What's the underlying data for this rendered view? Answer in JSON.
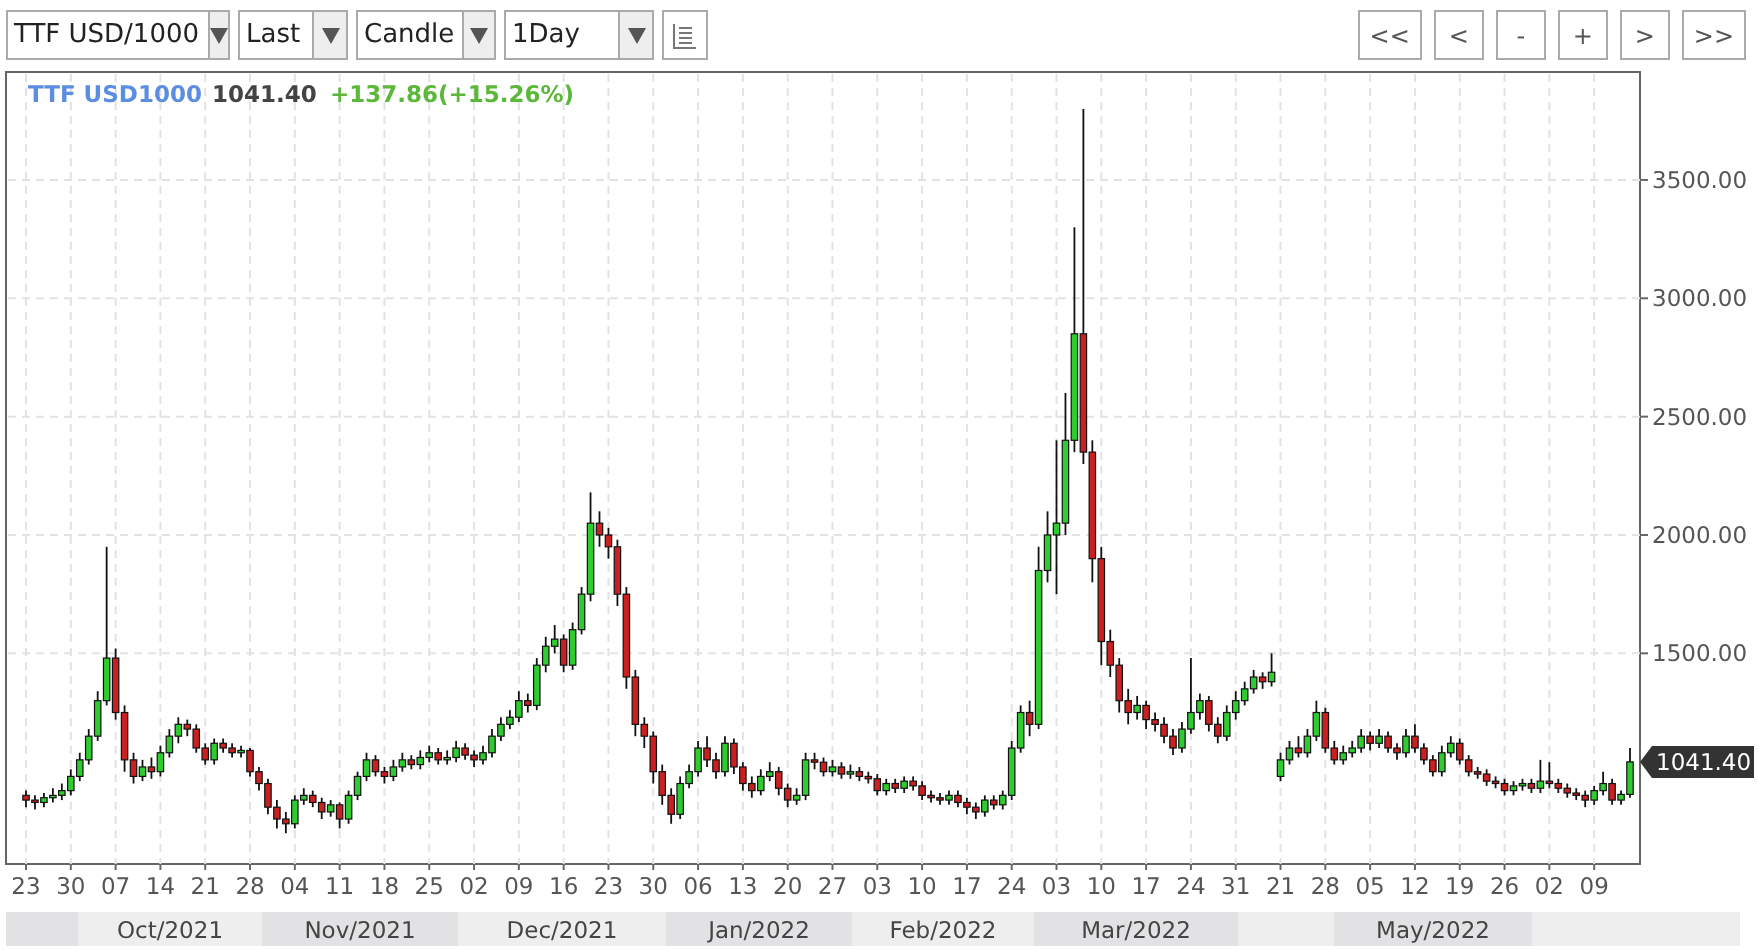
{
  "toolbar": {
    "dropdowns": [
      {
        "value": "TTF USD/1000"
      },
      {
        "value": "Last"
      },
      {
        "value": "Candle"
      },
      {
        "value": "1Day"
      }
    ],
    "nav_buttons": [
      "<<",
      "<",
      "-",
      "+",
      ">",
      ">>"
    ]
  },
  "chart": {
    "legend": {
      "symbol": "TTF USD1000",
      "price": "1041.40",
      "change": "+137.86(+15.26%)"
    },
    "last_price_tag": "1041.40",
    "month_labels": [
      "Oct/2021",
      "Nov/2021",
      "Dec/2021",
      "Jan/2022",
      "Feb/2022",
      "Mar/2022",
      "May/2022"
    ],
    "chart_data": {
      "type": "candlestick",
      "grid": true,
      "ylim": [
        610,
        3956
      ],
      "yticks": [
        {
          "value": 1500,
          "label": "1500.00"
        },
        {
          "value": 2000,
          "label": "2000.00"
        },
        {
          "value": 2500,
          "label": "2500.00"
        },
        {
          "value": 3000,
          "label": "3000.00"
        },
        {
          "value": 3500,
          "label": "3500.00"
        }
      ],
      "categories": [
        "23",
        null,
        null,
        null,
        null,
        "30",
        null,
        null,
        null,
        null,
        "07",
        null,
        null,
        null,
        null,
        "14",
        null,
        null,
        null,
        null,
        "21",
        null,
        null,
        null,
        null,
        "28",
        null,
        null,
        null,
        null,
        "04",
        null,
        null,
        null,
        null,
        "11",
        null,
        null,
        null,
        null,
        "18",
        null,
        null,
        null,
        null,
        "25",
        null,
        null,
        null,
        null,
        "02",
        null,
        null,
        null,
        null,
        "09",
        null,
        null,
        null,
        null,
        "16",
        null,
        null,
        null,
        null,
        "23",
        null,
        null,
        null,
        null,
        "30",
        null,
        null,
        null,
        null,
        "06",
        null,
        null,
        null,
        null,
        "13",
        null,
        null,
        null,
        null,
        "20",
        null,
        null,
        null,
        null,
        "27",
        null,
        null,
        null,
        null,
        "03",
        null,
        null,
        null,
        null,
        "10",
        null,
        null,
        null,
        null,
        "17",
        null,
        null,
        null,
        null,
        "24",
        null,
        null,
        null,
        null,
        "03",
        null,
        null,
        null,
        null,
        "10",
        null,
        null,
        null,
        null,
        "17",
        null,
        null,
        null,
        null,
        "24",
        null,
        null,
        null,
        null,
        "31",
        null,
        null,
        null,
        null,
        "21",
        null,
        null,
        null,
        null,
        "28",
        null,
        null,
        null,
        null,
        "05",
        null,
        null,
        null,
        null,
        "12",
        null,
        null,
        null,
        null,
        "19",
        null,
        null,
        null,
        null,
        "26",
        null,
        null,
        null,
        null,
        "02",
        null,
        null,
        null,
        null,
        "09",
        null,
        null,
        null,
        null
      ],
      "ohlc": [
        [
          900,
          920,
          850,
          880
        ],
        [
          880,
          900,
          840,
          870
        ],
        [
          870,
          910,
          850,
          890
        ],
        [
          890,
          930,
          870,
          900
        ],
        [
          900,
          950,
          880,
          920
        ],
        [
          920,
          1010,
          900,
          980
        ],
        [
          980,
          1080,
          960,
          1050
        ],
        [
          1050,
          1180,
          1030,
          1150
        ],
        [
          1150,
          1340,
          1130,
          1300
        ],
        [
          1300,
          1950,
          1280,
          1480
        ],
        [
          1480,
          1520,
          1220,
          1250
        ],
        [
          1250,
          1280,
          1000,
          1050
        ],
        [
          1050,
          1080,
          950,
          980
        ],
        [
          980,
          1050,
          960,
          1020
        ],
        [
          1020,
          1060,
          970,
          1000
        ],
        [
          1000,
          1110,
          980,
          1080
        ],
        [
          1080,
          1180,
          1060,
          1150
        ],
        [
          1150,
          1230,
          1120,
          1200
        ],
        [
          1200,
          1220,
          1150,
          1180
        ],
        [
          1180,
          1200,
          1080,
          1100
        ],
        [
          1100,
          1120,
          1030,
          1050
        ],
        [
          1050,
          1140,
          1030,
          1120
        ],
        [
          1120,
          1140,
          1080,
          1100
        ],
        [
          1100,
          1120,
          1060,
          1080
        ],
        [
          1080,
          1110,
          1060,
          1090
        ],
        [
          1090,
          1100,
          980,
          1000
        ],
        [
          1000,
          1020,
          920,
          950
        ],
        [
          950,
          970,
          820,
          850
        ],
        [
          850,
          880,
          760,
          800
        ],
        [
          800,
          830,
          740,
          780
        ],
        [
          780,
          900,
          760,
          880
        ],
        [
          880,
          930,
          860,
          900
        ],
        [
          900,
          920,
          850,
          870
        ],
        [
          870,
          890,
          800,
          830
        ],
        [
          830,
          880,
          810,
          860
        ],
        [
          860,
          870,
          760,
          800
        ],
        [
          800,
          920,
          780,
          900
        ],
        [
          900,
          1000,
          880,
          980
        ],
        [
          980,
          1080,
          960,
          1050
        ],
        [
          1050,
          1070,
          980,
          1000
        ],
        [
          1000,
          1020,
          950,
          980
        ],
        [
          980,
          1050,
          960,
          1020
        ],
        [
          1020,
          1080,
          1000,
          1050
        ],
        [
          1050,
          1070,
          1010,
          1030
        ],
        [
          1030,
          1090,
          1010,
          1060
        ],
        [
          1060,
          1110,
          1040,
          1080
        ],
        [
          1080,
          1100,
          1030,
          1050
        ],
        [
          1050,
          1090,
          1030,
          1060
        ],
        [
          1060,
          1130,
          1040,
          1100
        ],
        [
          1100,
          1120,
          1050,
          1070
        ],
        [
          1070,
          1090,
          1020,
          1050
        ],
        [
          1050,
          1110,
          1030,
          1080
        ],
        [
          1080,
          1180,
          1060,
          1150
        ],
        [
          1150,
          1230,
          1130,
          1200
        ],
        [
          1200,
          1260,
          1180,
          1230
        ],
        [
          1230,
          1340,
          1210,
          1300
        ],
        [
          1300,
          1330,
          1250,
          1280
        ],
        [
          1280,
          1480,
          1260,
          1450
        ],
        [
          1450,
          1570,
          1420,
          1530
        ],
        [
          1530,
          1620,
          1500,
          1560
        ],
        [
          1560,
          1580,
          1420,
          1450
        ],
        [
          1450,
          1630,
          1430,
          1600
        ],
        [
          1600,
          1780,
          1580,
          1750
        ],
        [
          1750,
          2180,
          1720,
          2050
        ],
        [
          2050,
          2100,
          1950,
          2000
        ],
        [
          2000,
          2030,
          1900,
          1950
        ],
        [
          1950,
          1980,
          1700,
          1750
        ],
        [
          1750,
          1780,
          1350,
          1400
        ],
        [
          1400,
          1430,
          1150,
          1200
        ],
        [
          1200,
          1230,
          1100,
          1150
        ],
        [
          1150,
          1170,
          950,
          1000
        ],
        [
          1000,
          1030,
          860,
          900
        ],
        [
          900,
          930,
          780,
          820
        ],
        [
          820,
          980,
          800,
          950
        ],
        [
          950,
          1030,
          930,
          1000
        ],
        [
          1000,
          1130,
          980,
          1100
        ],
        [
          1100,
          1150,
          1020,
          1050
        ],
        [
          1050,
          1080,
          970,
          1000
        ],
        [
          1000,
          1150,
          980,
          1120
        ],
        [
          1120,
          1140,
          990,
          1020
        ],
        [
          1020,
          1040,
          920,
          950
        ],
        [
          950,
          980,
          890,
          920
        ],
        [
          920,
          1010,
          900,
          980
        ],
        [
          980,
          1040,
          960,
          1000
        ],
        [
          1000,
          1020,
          900,
          930
        ],
        [
          930,
          950,
          850,
          880
        ],
        [
          880,
          930,
          860,
          900
        ],
        [
          900,
          1080,
          880,
          1050
        ],
        [
          1050,
          1080,
          1010,
          1040
        ],
        [
          1040,
          1060,
          980,
          1000
        ],
        [
          1000,
          1050,
          980,
          1020
        ],
        [
          1020,
          1040,
          970,
          990
        ],
        [
          990,
          1030,
          970,
          1000
        ],
        [
          1000,
          1020,
          960,
          980
        ],
        [
          980,
          1000,
          950,
          970
        ],
        [
          970,
          990,
          900,
          920
        ],
        [
          920,
          970,
          900,
          950
        ],
        [
          950,
          970,
          910,
          930
        ],
        [
          930,
          980,
          910,
          960
        ],
        [
          960,
          980,
          920,
          940
        ],
        [
          940,
          960,
          880,
          900
        ],
        [
          900,
          920,
          870,
          890
        ],
        [
          890,
          910,
          860,
          880
        ],
        [
          880,
          920,
          860,
          900
        ],
        [
          900,
          920,
          850,
          870
        ],
        [
          870,
          890,
          820,
          850
        ],
        [
          850,
          870,
          800,
          830
        ],
        [
          830,
          900,
          810,
          880
        ],
        [
          880,
          900,
          840,
          860
        ],
        [
          860,
          920,
          840,
          900
        ],
        [
          900,
          1130,
          880,
          1100
        ],
        [
          1100,
          1280,
          1080,
          1250
        ],
        [
          1250,
          1300,
          1150,
          1200
        ],
        [
          1200,
          1950,
          1180,
          1850
        ],
        [
          1850,
          2100,
          1800,
          2000
        ],
        [
          2000,
          2400,
          1750,
          2050
        ],
        [
          2050,
          2600,
          2000,
          2400
        ],
        [
          2400,
          3300,
          2350,
          2850
        ],
        [
          2850,
          3800,
          2300,
          2350
        ],
        [
          2350,
          2400,
          1800,
          1900
        ],
        [
          1900,
          1950,
          1450,
          1550
        ],
        [
          1550,
          1600,
          1400,
          1450
        ],
        [
          1450,
          1480,
          1250,
          1300
        ],
        [
          1300,
          1350,
          1200,
          1250
        ],
        [
          1250,
          1320,
          1220,
          1280
        ],
        [
          1280,
          1300,
          1180,
          1220
        ],
        [
          1220,
          1250,
          1170,
          1200
        ],
        [
          1200,
          1230,
          1120,
          1150
        ],
        [
          1150,
          1180,
          1070,
          1100
        ],
        [
          1100,
          1210,
          1080,
          1180
        ],
        [
          1180,
          1480,
          1160,
          1250
        ],
        [
          1250,
          1330,
          1220,
          1300
        ],
        [
          1300,
          1320,
          1170,
          1200
        ],
        [
          1200,
          1230,
          1120,
          1150
        ],
        [
          1150,
          1280,
          1130,
          1250
        ],
        [
          1250,
          1340,
          1220,
          1300
        ],
        [
          1300,
          1380,
          1280,
          1350
        ],
        [
          1350,
          1430,
          1330,
          1400
        ],
        [
          1400,
          1420,
          1350,
          1380
        ],
        [
          1380,
          1500,
          1360,
          1420
        ],
        [
          980,
          1080,
          960,
          1050
        ],
        [
          1050,
          1130,
          1030,
          1100
        ],
        [
          1100,
          1150,
          1060,
          1080
        ],
        [
          1080,
          1180,
          1060,
          1150
        ],
        [
          1150,
          1300,
          1130,
          1250
        ],
        [
          1250,
          1270,
          1080,
          1100
        ],
        [
          1100,
          1130,
          1030,
          1050
        ],
        [
          1050,
          1110,
          1030,
          1080
        ],
        [
          1080,
          1130,
          1060,
          1100
        ],
        [
          1100,
          1180,
          1080,
          1150
        ],
        [
          1150,
          1170,
          1090,
          1120
        ],
        [
          1120,
          1180,
          1100,
          1150
        ],
        [
          1150,
          1170,
          1080,
          1100
        ],
        [
          1100,
          1120,
          1050,
          1080
        ],
        [
          1080,
          1180,
          1060,
          1150
        ],
        [
          1150,
          1200,
          1080,
          1100
        ],
        [
          1100,
          1120,
          1030,
          1050
        ],
        [
          1050,
          1070,
          980,
          1000
        ],
        [
          1000,
          1110,
          980,
          1080
        ],
        [
          1080,
          1150,
          1060,
          1120
        ],
        [
          1120,
          1140,
          1030,
          1050
        ],
        [
          1050,
          1070,
          980,
          1000
        ],
        [
          1000,
          1020,
          970,
          990
        ],
        [
          990,
          1010,
          940,
          960
        ],
        [
          960,
          980,
          930,
          950
        ],
        [
          950,
          970,
          900,
          920
        ],
        [
          920,
          960,
          900,
          940
        ],
        [
          940,
          970,
          920,
          950
        ],
        [
          950,
          970,
          910,
          930
        ],
        [
          930,
          1050,
          910,
          960
        ],
        [
          960,
          1040,
          930,
          950
        ],
        [
          950,
          970,
          910,
          930
        ],
        [
          930,
          950,
          890,
          910
        ],
        [
          910,
          930,
          880,
          900
        ],
        [
          900,
          920,
          850,
          880
        ],
        [
          880,
          940,
          860,
          920
        ],
        [
          920,
          1000,
          900,
          950
        ],
        [
          950,
          970,
          860,
          880
        ],
        [
          880,
          920,
          860,
          904
        ],
        [
          904,
          1100,
          890,
          1041.4
        ]
      ]
    }
  }
}
